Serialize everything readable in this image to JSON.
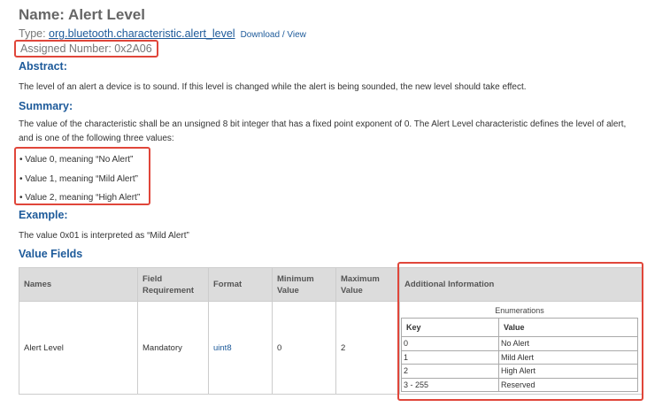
{
  "header": {
    "title": "Name: Alert Level",
    "type_prefix": "Type: ",
    "type_value": "org.bluetooth.characteristic.alert_level",
    "download_view": "Download / View",
    "assigned_number": "Assigned Number: 0x2A06"
  },
  "sections": {
    "abstract_heading": "Abstract:",
    "abstract_text": "The level of an alert a device is to sound. If this level is changed while the alert is being sounded, the new level should take effect.",
    "summary_heading": "Summary:",
    "summary_text": "The value of the characteristic shall be an unsigned 8 bit integer that has a fixed point exponent of 0. The Alert Level characteristic defines the level of alert, and is one of the following three values:",
    "bullets": [
      "• Value 0, meaning “No Alert”",
      "• Value 1, meaning “Mild Alert”",
      "• Value 2, meaning “High Alert”"
    ],
    "example_heading": "Example:",
    "example_text": "The value 0x01 is interpreted as “Mild Alert”",
    "value_fields_heading": "Value Fields"
  },
  "value_fields": {
    "headers": [
      "Names",
      "Field Requirement",
      "Format",
      "Minimum Value",
      "Maximum Value",
      "Additional Information"
    ],
    "row": {
      "name": "Alert Level",
      "requirement": "Mandatory",
      "format": "uint8",
      "minimum": "0",
      "maximum": "2"
    },
    "enumerations": {
      "title": "Enumerations",
      "key_header": "Key",
      "value_header": "Value",
      "rows": [
        {
          "key": "0",
          "value": "No Alert"
        },
        {
          "key": "1",
          "value": "Mild Alert"
        },
        {
          "key": "2",
          "value": "High Alert"
        },
        {
          "key": "3 - 255",
          "value": "Reserved"
        }
      ]
    }
  },
  "colors": {
    "heading_blue": "#1d5a9a",
    "highlight_red": "#e0463a"
  }
}
